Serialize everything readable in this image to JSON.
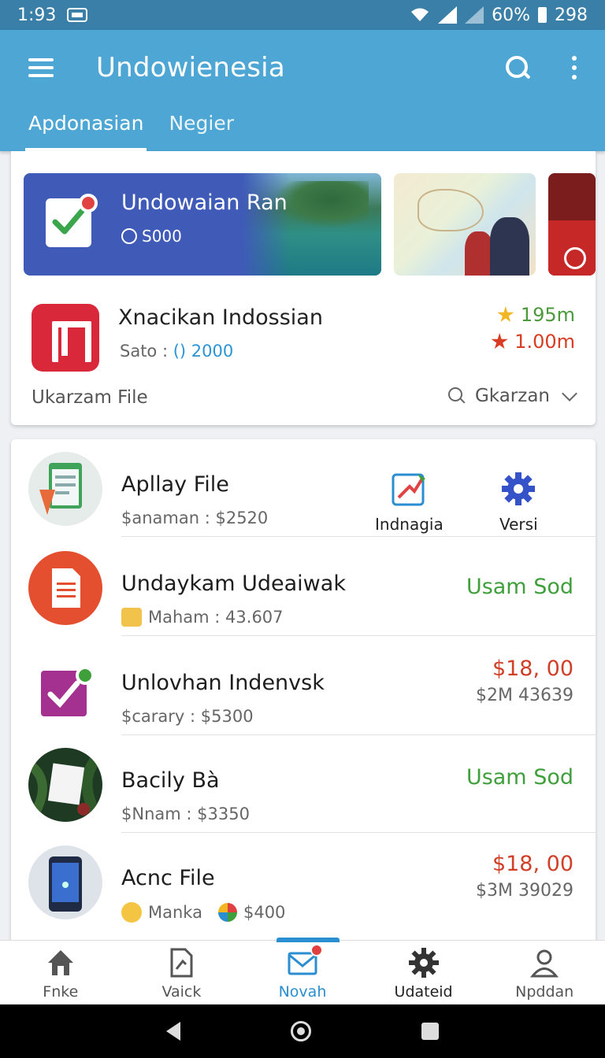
{
  "status_bar": {
    "time": "1:93",
    "battery": "60%",
    "extra": "298"
  },
  "app_bar": {
    "title": "Undowienesia"
  },
  "tabs": [
    {
      "label": "Apdonasian"
    },
    {
      "label": "Negier"
    }
  ],
  "featured": {
    "banner": {
      "title": "Undowaian  Ran",
      "subtitle": "S000"
    }
  },
  "highlight_app": {
    "name": "Xnacikan Indossian",
    "sub_label": "Sato :",
    "sub_value": "() 2000",
    "stat1": "195m",
    "stat2": "1.00m"
  },
  "file_section": {
    "label": "Ukarzam File",
    "filter": "Gkarzan"
  },
  "list": [
    {
      "title": "Apllay File",
      "sub": "$anaman : $2520",
      "actions": [
        {
          "label": "Indnagia"
        },
        {
          "label": "Versi"
        }
      ]
    },
    {
      "title": "Undaykam Udeaiwak",
      "sub": "Maham : 43.607",
      "status": "Usam Sod"
    },
    {
      "title": "Unlovhan Indenvsk",
      "sub": "$carary : $5300",
      "price": "$18, 00",
      "detail": "$2M 43639"
    },
    {
      "title": "Bacily Bà",
      "sub": "$Nnam : $3350",
      "status": "Usam Sod"
    },
    {
      "title": "Acnc File",
      "sub": "Manka",
      "sub2": "$400",
      "price": "$18, 00",
      "detail": "$3M 39029"
    }
  ],
  "bottom_nav": [
    {
      "label": "Fnke",
      "icon": "home-icon"
    },
    {
      "label": "Vaick",
      "icon": "document-icon"
    },
    {
      "label": "Novah",
      "icon": "mail-icon"
    },
    {
      "label": "Udateid",
      "icon": "gear-icon"
    },
    {
      "label": "Npddan",
      "icon": "person-icon"
    }
  ],
  "colors": {
    "app_bar": "#4ea6d4",
    "status_bar": "#3a7fa8",
    "accent": "#2b8ed0",
    "green": "#3fa03b",
    "red": "#d13f27"
  }
}
